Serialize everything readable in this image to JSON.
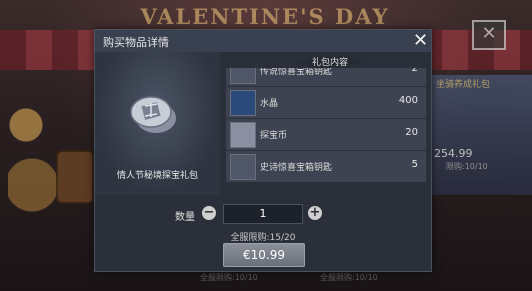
{
  "background": {
    "banner": "VALENTINE'S DAY",
    "right_shop": {
      "title": "坐骑养成礼包",
      "price": "254.99",
      "limit": "限购:10/10"
    },
    "bottom_texts": [
      "全服限购:10/10",
      "全服限购:10/10"
    ]
  },
  "modal": {
    "title": "购买物品详情",
    "bundle_name": "情人节秘境探宝礼包",
    "contents_title": "礼包内容",
    "items": [
      {
        "name": "传说惊喜宝箱钥匙",
        "qty": "2",
        "icon": "key-icon"
      },
      {
        "name": "水晶",
        "qty": "400",
        "icon": "crystal-icon"
      },
      {
        "name": "探宝币",
        "qty": "20",
        "icon": "coin-icon"
      },
      {
        "name": "史诗惊喜宝箱钥匙",
        "qty": "5",
        "icon": "key-icon"
      }
    ],
    "quantity_label": "数量",
    "quantity_value": "1",
    "limit_text": "全服限购:15/20",
    "price": "€10.99"
  },
  "colors": {
    "panel": "#2b2f39",
    "header": "#394050",
    "row": "#3d4350",
    "button": "#7a808a"
  }
}
